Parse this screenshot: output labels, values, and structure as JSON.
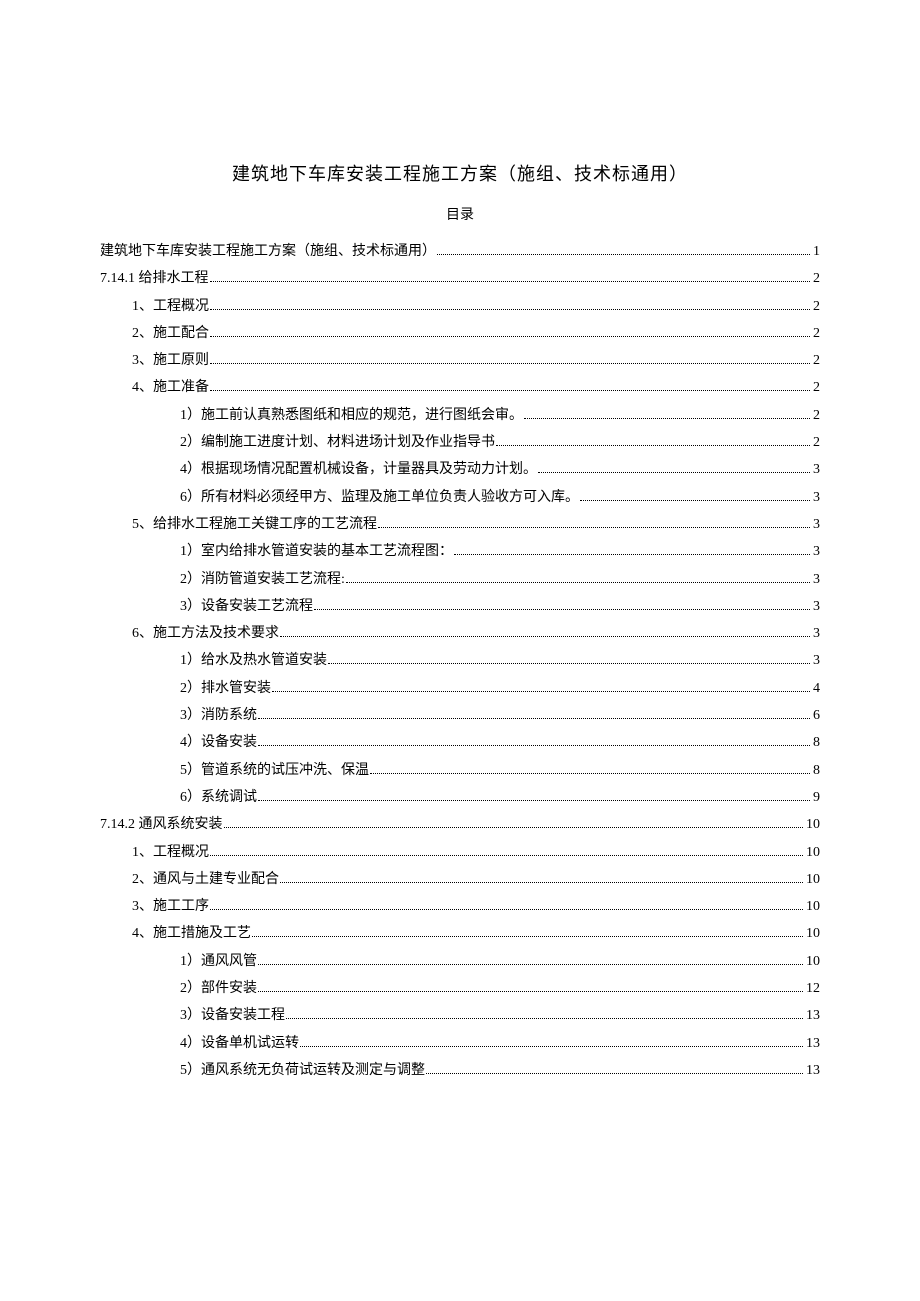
{
  "title": "建筑地下车库安装工程施工方案（施组、技术标通用）",
  "subtitle": "目录",
  "toc": [
    {
      "level": 0,
      "text": "建筑地下车库安装工程施工方案（施组、技术标通用）",
      "page": "1"
    },
    {
      "level": 0,
      "text": "7.14.1 给排水工程",
      "page": "2"
    },
    {
      "level": 1,
      "text": "1、工程概况",
      "page": "2"
    },
    {
      "level": 1,
      "text": "2、施工配合",
      "page": "2"
    },
    {
      "level": 1,
      "text": "3、施工原则",
      "page": "2"
    },
    {
      "level": 1,
      "text": "4、施工准备",
      "page": "2"
    },
    {
      "level": 2,
      "text": "1）施工前认真熟悉图纸和相应的规范，进行图纸会审。",
      "page": "2"
    },
    {
      "level": 2,
      "text": "2）编制施工进度计划、材料进场计划及作业指导书",
      "page": "2"
    },
    {
      "level": 2,
      "text": "4）根据现场情况配置机械设备，计量器具及劳动力计划。",
      "page": "3"
    },
    {
      "level": 2,
      "text": "6）所有材料必须经甲方、监理及施工单位负责人验收方可入库。",
      "page": "3"
    },
    {
      "level": 1,
      "text": "5、给排水工程施工关键工序的工艺流程",
      "page": "3"
    },
    {
      "level": 2,
      "text": "1）室内给排水管道安装的基本工艺流程图：",
      "page": "3"
    },
    {
      "level": 2,
      "text": "2）消防管道安装工艺流程:",
      "page": "3"
    },
    {
      "level": 2,
      "text": "3）设备安装工艺流程",
      "page": "3"
    },
    {
      "level": 1,
      "text": "6、施工方法及技术要求",
      "page": "3"
    },
    {
      "level": 2,
      "text": "1）给水及热水管道安装",
      "page": "3"
    },
    {
      "level": 2,
      "text": "2）排水管安装",
      "page": "4"
    },
    {
      "level": 2,
      "text": "3）消防系统",
      "page": "6"
    },
    {
      "level": 2,
      "text": "4）设备安装",
      "page": "8"
    },
    {
      "level": 2,
      "text": "5）管道系统的试压冲洗、保温",
      "page": "8"
    },
    {
      "level": 2,
      "text": "6）系统调试",
      "page": "9"
    },
    {
      "level": 0,
      "text": "7.14.2 通风系统安装",
      "page": "10"
    },
    {
      "level": 1,
      "text": "1、工程概况",
      "page": "10"
    },
    {
      "level": 1,
      "text": "2、通风与土建专业配合",
      "page": "10"
    },
    {
      "level": 1,
      "text": "3、施工工序",
      "page": "10"
    },
    {
      "level": 1,
      "text": "4、施工措施及工艺",
      "page": "10"
    },
    {
      "level": 2,
      "text": "1）通风风管",
      "page": "10"
    },
    {
      "level": 2,
      "text": "2）部件安装",
      "page": "12"
    },
    {
      "level": 2,
      "text": "3）设备安装工程",
      "page": "13"
    },
    {
      "level": 2,
      "text": "4）设备单机试运转",
      "page": "13"
    },
    {
      "level": 2,
      "text": "5）通风系统无负荷试运转及测定与调整",
      "page": "13"
    }
  ]
}
